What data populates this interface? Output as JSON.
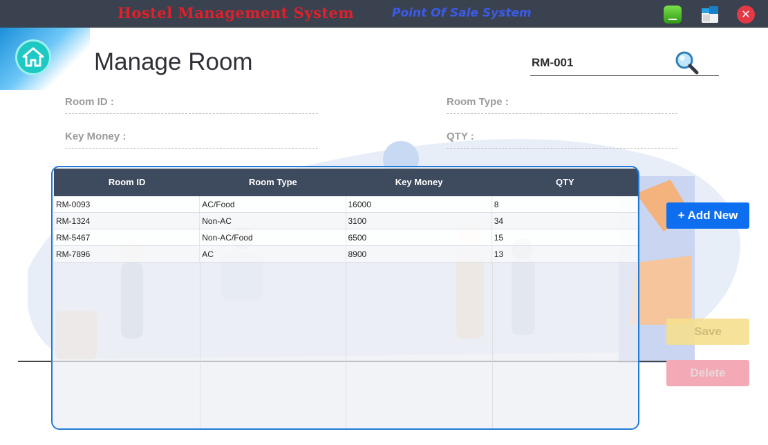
{
  "titlebar": {
    "title": "Hostel Management System",
    "subtitle": "Point Of Sale System",
    "minimize_icon": "minimize-icon",
    "maximize_icon": "restore-icon",
    "close_icon": "close-icon",
    "close_glyph": "✕"
  },
  "home": {
    "icon": "home-icon"
  },
  "page": {
    "title": "Manage Room"
  },
  "search": {
    "value": "RM-001",
    "icon": "search-icon"
  },
  "form": {
    "room_id_label": "Room ID :",
    "room_type_label": "Room Type :",
    "key_money_label": "Key Money :",
    "qty_label": "QTY :"
  },
  "table": {
    "headers": [
      "Room ID",
      "Room Type",
      "Key Money",
      "QTY"
    ],
    "rows": [
      [
        "RM-0093",
        "AC/Food",
        "16000",
        "8"
      ],
      [
        "RM-1324",
        "Non-AC",
        "3100",
        "34"
      ],
      [
        "RM-5467",
        "Non-AC/Food",
        "6500",
        "15"
      ],
      [
        "RM-7896",
        "AC",
        "8900",
        "13"
      ]
    ]
  },
  "actions": {
    "add_new": "+ Add New",
    "save": "Save",
    "delete": "Delete"
  },
  "colors": {
    "titlebar_bg": "#3a4250",
    "title_red": "#e0202a",
    "subtitle_blue": "#3b5be6",
    "table_header": "#3e4a5e",
    "table_border": "#1f7bd6",
    "add_button": "#0d6ff0",
    "save_button": "#f6e08f",
    "delete_button": "#f4aab6"
  }
}
